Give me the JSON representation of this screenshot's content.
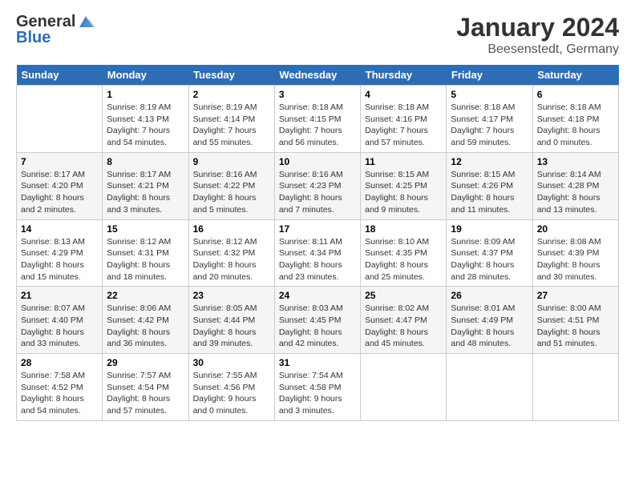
{
  "header": {
    "logo_general": "General",
    "logo_blue": "Blue",
    "month": "January 2024",
    "location": "Beesenstedt, Germany"
  },
  "days_of_week": [
    "Sunday",
    "Monday",
    "Tuesday",
    "Wednesday",
    "Thursday",
    "Friday",
    "Saturday"
  ],
  "weeks": [
    [
      {
        "day": "",
        "sunrise": "",
        "sunset": "",
        "daylight": ""
      },
      {
        "day": "1",
        "sunrise": "Sunrise: 8:19 AM",
        "sunset": "Sunset: 4:13 PM",
        "daylight": "Daylight: 7 hours and 54 minutes."
      },
      {
        "day": "2",
        "sunrise": "Sunrise: 8:19 AM",
        "sunset": "Sunset: 4:14 PM",
        "daylight": "Daylight: 7 hours and 55 minutes."
      },
      {
        "day": "3",
        "sunrise": "Sunrise: 8:18 AM",
        "sunset": "Sunset: 4:15 PM",
        "daylight": "Daylight: 7 hours and 56 minutes."
      },
      {
        "day": "4",
        "sunrise": "Sunrise: 8:18 AM",
        "sunset": "Sunset: 4:16 PM",
        "daylight": "Daylight: 7 hours and 57 minutes."
      },
      {
        "day": "5",
        "sunrise": "Sunrise: 8:18 AM",
        "sunset": "Sunset: 4:17 PM",
        "daylight": "Daylight: 7 hours and 59 minutes."
      },
      {
        "day": "6",
        "sunrise": "Sunrise: 8:18 AM",
        "sunset": "Sunset: 4:18 PM",
        "daylight": "Daylight: 8 hours and 0 minutes."
      }
    ],
    [
      {
        "day": "7",
        "sunrise": "Sunrise: 8:17 AM",
        "sunset": "Sunset: 4:20 PM",
        "daylight": "Daylight: 8 hours and 2 minutes."
      },
      {
        "day": "8",
        "sunrise": "Sunrise: 8:17 AM",
        "sunset": "Sunset: 4:21 PM",
        "daylight": "Daylight: 8 hours and 3 minutes."
      },
      {
        "day": "9",
        "sunrise": "Sunrise: 8:16 AM",
        "sunset": "Sunset: 4:22 PM",
        "daylight": "Daylight: 8 hours and 5 minutes."
      },
      {
        "day": "10",
        "sunrise": "Sunrise: 8:16 AM",
        "sunset": "Sunset: 4:23 PM",
        "daylight": "Daylight: 8 hours and 7 minutes."
      },
      {
        "day": "11",
        "sunrise": "Sunrise: 8:15 AM",
        "sunset": "Sunset: 4:25 PM",
        "daylight": "Daylight: 8 hours and 9 minutes."
      },
      {
        "day": "12",
        "sunrise": "Sunrise: 8:15 AM",
        "sunset": "Sunset: 4:26 PM",
        "daylight": "Daylight: 8 hours and 11 minutes."
      },
      {
        "day": "13",
        "sunrise": "Sunrise: 8:14 AM",
        "sunset": "Sunset: 4:28 PM",
        "daylight": "Daylight: 8 hours and 13 minutes."
      }
    ],
    [
      {
        "day": "14",
        "sunrise": "Sunrise: 8:13 AM",
        "sunset": "Sunset: 4:29 PM",
        "daylight": "Daylight: 8 hours and 15 minutes."
      },
      {
        "day": "15",
        "sunrise": "Sunrise: 8:12 AM",
        "sunset": "Sunset: 4:31 PM",
        "daylight": "Daylight: 8 hours and 18 minutes."
      },
      {
        "day": "16",
        "sunrise": "Sunrise: 8:12 AM",
        "sunset": "Sunset: 4:32 PM",
        "daylight": "Daylight: 8 hours and 20 minutes."
      },
      {
        "day": "17",
        "sunrise": "Sunrise: 8:11 AM",
        "sunset": "Sunset: 4:34 PM",
        "daylight": "Daylight: 8 hours and 23 minutes."
      },
      {
        "day": "18",
        "sunrise": "Sunrise: 8:10 AM",
        "sunset": "Sunset: 4:35 PM",
        "daylight": "Daylight: 8 hours and 25 minutes."
      },
      {
        "day": "19",
        "sunrise": "Sunrise: 8:09 AM",
        "sunset": "Sunset: 4:37 PM",
        "daylight": "Daylight: 8 hours and 28 minutes."
      },
      {
        "day": "20",
        "sunrise": "Sunrise: 8:08 AM",
        "sunset": "Sunset: 4:39 PM",
        "daylight": "Daylight: 8 hours and 30 minutes."
      }
    ],
    [
      {
        "day": "21",
        "sunrise": "Sunrise: 8:07 AM",
        "sunset": "Sunset: 4:40 PM",
        "daylight": "Daylight: 8 hours and 33 minutes."
      },
      {
        "day": "22",
        "sunrise": "Sunrise: 8:06 AM",
        "sunset": "Sunset: 4:42 PM",
        "daylight": "Daylight: 8 hours and 36 minutes."
      },
      {
        "day": "23",
        "sunrise": "Sunrise: 8:05 AM",
        "sunset": "Sunset: 4:44 PM",
        "daylight": "Daylight: 8 hours and 39 minutes."
      },
      {
        "day": "24",
        "sunrise": "Sunrise: 8:03 AM",
        "sunset": "Sunset: 4:45 PM",
        "daylight": "Daylight: 8 hours and 42 minutes."
      },
      {
        "day": "25",
        "sunrise": "Sunrise: 8:02 AM",
        "sunset": "Sunset: 4:47 PM",
        "daylight": "Daylight: 8 hours and 45 minutes."
      },
      {
        "day": "26",
        "sunrise": "Sunrise: 8:01 AM",
        "sunset": "Sunset: 4:49 PM",
        "daylight": "Daylight: 8 hours and 48 minutes."
      },
      {
        "day": "27",
        "sunrise": "Sunrise: 8:00 AM",
        "sunset": "Sunset: 4:51 PM",
        "daylight": "Daylight: 8 hours and 51 minutes."
      }
    ],
    [
      {
        "day": "28",
        "sunrise": "Sunrise: 7:58 AM",
        "sunset": "Sunset: 4:52 PM",
        "daylight": "Daylight: 8 hours and 54 minutes."
      },
      {
        "day": "29",
        "sunrise": "Sunrise: 7:57 AM",
        "sunset": "Sunset: 4:54 PM",
        "daylight": "Daylight: 8 hours and 57 minutes."
      },
      {
        "day": "30",
        "sunrise": "Sunrise: 7:55 AM",
        "sunset": "Sunset: 4:56 PM",
        "daylight": "Daylight: 9 hours and 0 minutes."
      },
      {
        "day": "31",
        "sunrise": "Sunrise: 7:54 AM",
        "sunset": "Sunset: 4:58 PM",
        "daylight": "Daylight: 9 hours and 3 minutes."
      },
      {
        "day": "",
        "sunrise": "",
        "sunset": "",
        "daylight": ""
      },
      {
        "day": "",
        "sunrise": "",
        "sunset": "",
        "daylight": ""
      },
      {
        "day": "",
        "sunrise": "",
        "sunset": "",
        "daylight": ""
      }
    ]
  ]
}
